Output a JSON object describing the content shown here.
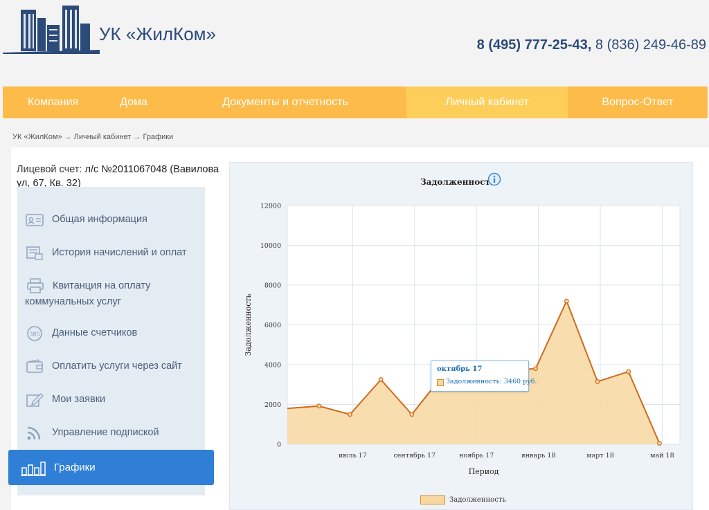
{
  "header": {
    "logo_title": "УК «ЖилКом»",
    "phone1": "8 (495) 777-25-43,",
    "phone2": " 8 (836) 249-46-89"
  },
  "nav": [
    {
      "label": "Компания",
      "active": false
    },
    {
      "label": "Дома",
      "active": false
    },
    {
      "label": "Документы и отчетность",
      "active": false
    },
    {
      "label": "Личный кабинет",
      "active": true
    },
    {
      "label": "Вопрос-Ответ",
      "active": false
    }
  ],
  "breadcrumb": "УК «ЖилКом» → Личный кабинет → Графики",
  "account": {
    "label": "Лицевой счет: ",
    "value": "л/с №2011067048 (Вавилова ул, 67, Кв. 32)"
  },
  "sidebar": {
    "items": [
      {
        "label": "Общая информация",
        "icon": "id-card-icon"
      },
      {
        "label": "История начислений и оплат",
        "icon": "history-icon"
      },
      {
        "label": "Квитанция на оплату коммунальных услуг",
        "icon": "printer-icon"
      },
      {
        "label": "Данные счетчиков",
        "icon": "meter-icon"
      },
      {
        "label": "Оплатить услуги через сайт",
        "icon": "wallet-icon"
      },
      {
        "label": "Мои заявки",
        "icon": "edit-icon"
      },
      {
        "label": "Управление подпиской",
        "icon": "rss-icon"
      }
    ],
    "active_label": "Графики",
    "active_icon": "bar-chart-icon"
  },
  "chart_data": {
    "type": "area",
    "title": "Задолженность",
    "xlabel": "Период",
    "ylabel": "Задолженность",
    "ylim": [
      0,
      12000
    ],
    "yticks": [
      0,
      2000,
      4000,
      6000,
      8000,
      10000,
      12000
    ],
    "xticks": [
      "июль 17",
      "сентябрь 17",
      "ноябрь 17",
      "январь 18",
      "март 18",
      "май 18"
    ],
    "x": [
      "май 17",
      "июнь 17",
      "июль 17",
      "август 17",
      "сентябрь 17",
      "октябрь 17",
      "ноябрь 17",
      "декабрь 17",
      "январь 18",
      "февраль 18",
      "март 18",
      "апрель 18",
      "май 18"
    ],
    "series": [
      {
        "name": "Задолженность",
        "values": [
          1800,
          1920,
          1500,
          3250,
          1500,
          3460,
          3500,
          3700,
          3800,
          7200,
          3150,
          3650,
          50
        ]
      }
    ],
    "legend": "bottom",
    "grid": true,
    "color_fill": "#f7d8a0",
    "color_line": "#d0691e"
  },
  "tooltip": {
    "title": "октябрь 17",
    "value": "Задолженность: 3460 руб."
  }
}
